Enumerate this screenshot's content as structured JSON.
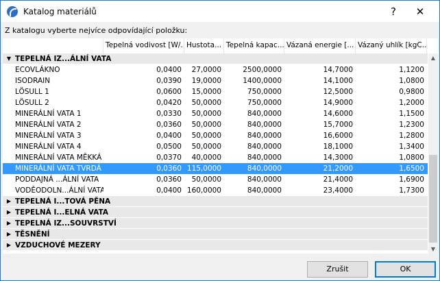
{
  "window": {
    "title": "Katalog materiálů",
    "help": "?",
    "close": "✕"
  },
  "prompt": "Z katalogu vyberte nejvíce odpovídající položku:",
  "columns": [
    "",
    "Tepelná vodivost [W/...",
    "Hustota...",
    "Tepelná kapac...",
    "Vázaná energie [...",
    "Vázaný uhlík [kgC..."
  ],
  "expanded_group": "TEPELNÁ IZ...ÁLNÍ VATA",
  "rows": [
    [
      "ECOVLÁKNO",
      "0,0400",
      "27,0000",
      "2500,0000",
      "14,7000",
      "1,1200"
    ],
    [
      "ISODRAIN",
      "0,0390",
      "19,0000",
      "1400,0000",
      "14,1000",
      "1,0800"
    ],
    [
      "LÖSULL 1",
      "0,0600",
      "15,0000",
      "750,0000",
      "12,5000",
      "0,9800"
    ],
    [
      "LÖSULL 2",
      "0,0420",
      "50,0000",
      "750,0000",
      "14,9000",
      "1,2000"
    ],
    [
      "MINERÁLNÍ VATA 1",
      "0,0330",
      "50,0000",
      "840,0000",
      "14,6000",
      "1,1500"
    ],
    [
      "MINERÁLNÍ VATA 2",
      "0,0360",
      "50,0000",
      "840,0000",
      "15,7000",
      "1,2300"
    ],
    [
      "MINERÁLNÍ VATA 3",
      "0,0400",
      "50,0000",
      "840,0000",
      "16,6000",
      "1,2800"
    ],
    [
      "MINERÁLNÍ VATA 4",
      "0,0500",
      "50,0000",
      "840,0000",
      "18,1000",
      "1,3400"
    ],
    [
      "MINERÁLNÍ VATA MĚKKÁ",
      "0,0370",
      "40,0000",
      "840,0000",
      "14,3000",
      "1,0800"
    ],
    [
      "MINERÁLNÍ VATA TVRDÁ",
      "0,0360",
      "115,0000",
      "840,0000",
      "21,2000",
      "1,6500"
    ],
    [
      "PODDAJNÁ ...ÁLNÍ VATA",
      "0,0360",
      "50,0000",
      "840,0000",
      "21,4000",
      "1,6900"
    ],
    [
      "VODĚODOLN...ÁLNÍ VATA",
      "0,0400",
      "160,0000",
      "840,0000",
      "23,4000",
      "1,7300"
    ]
  ],
  "selected_index": 9,
  "collapsed_groups": [
    "TEPELNÁ I...TOVÁ PĚNA",
    "TEPELNÁ I...ELNÁ VATA",
    "TEPELNÁ IZ...SOUVRSTVÍ",
    "TĚSNĚNÍ",
    "VZDUCHOVÉ MEZERY"
  ],
  "buttons": {
    "cancel": "Zrušit",
    "ok": "OK"
  }
}
